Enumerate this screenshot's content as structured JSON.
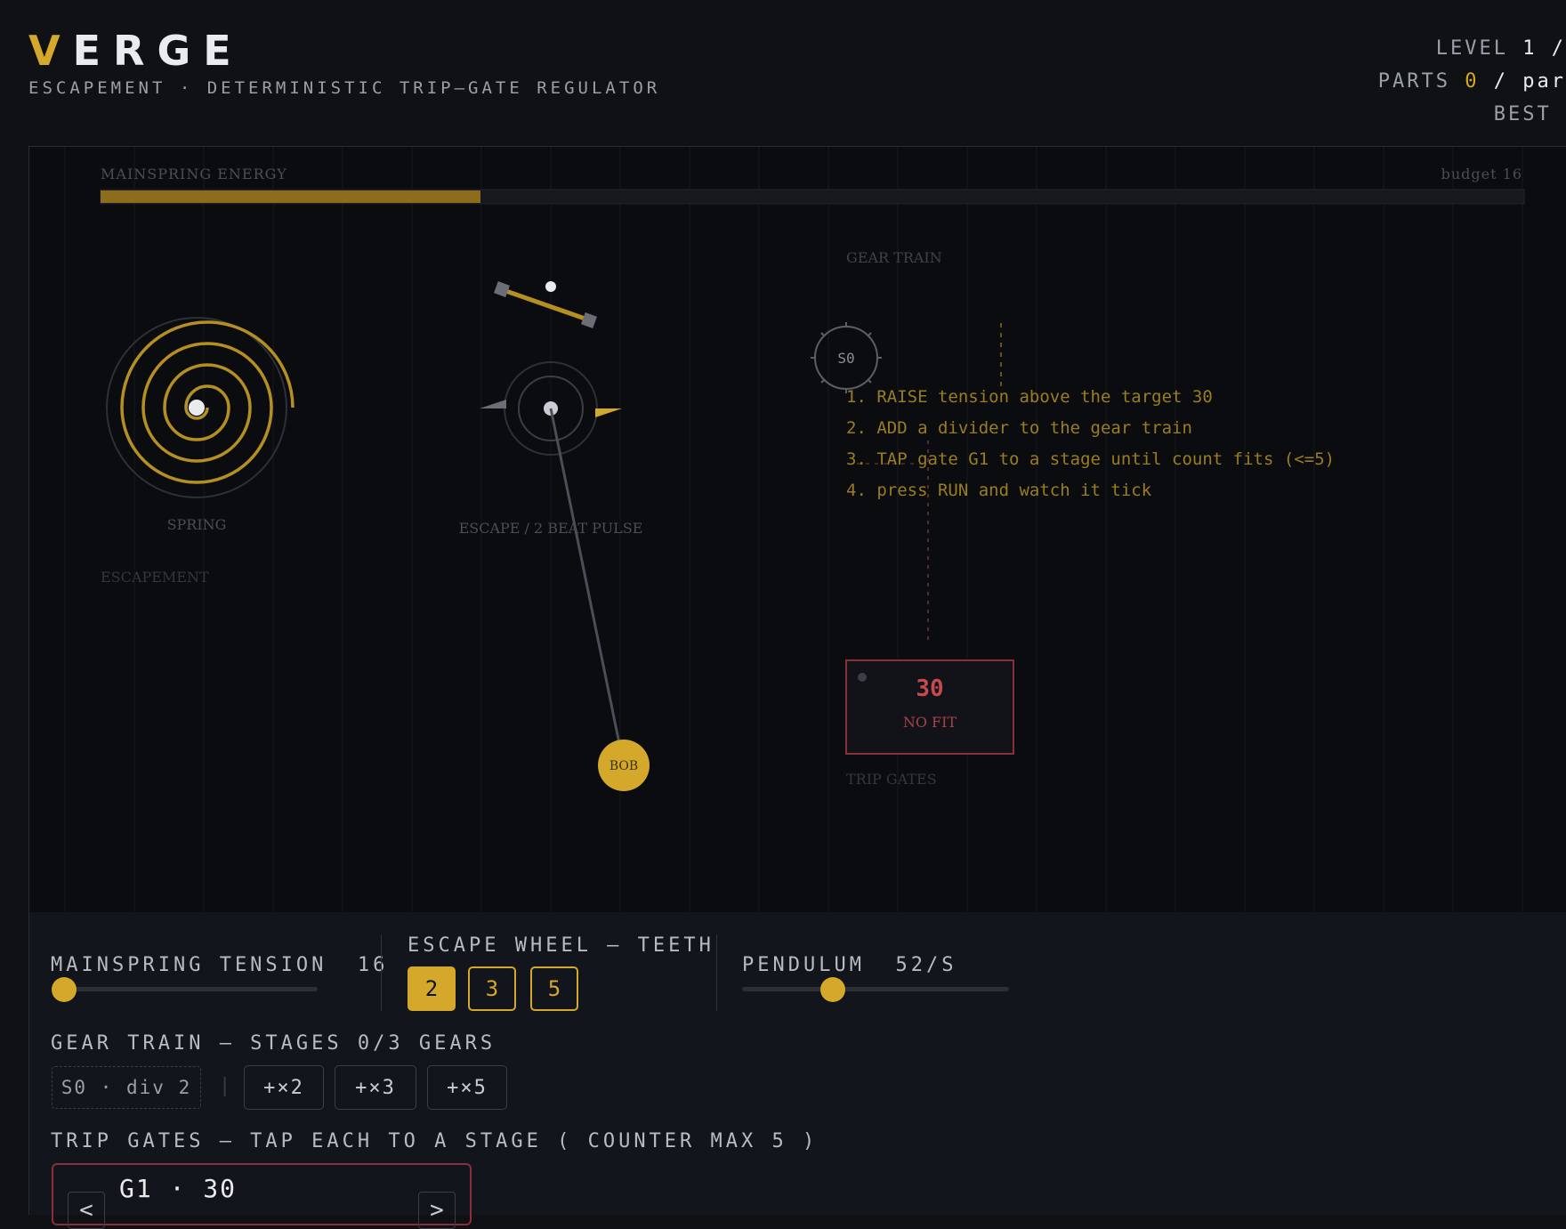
{
  "header": {
    "logo_first": "V",
    "logo_rest": "ERGE",
    "subtitle": "ESCAPEMENT · DETERMINISTIC TRIP–GATE REGULATOR"
  },
  "hud": {
    "level_label": "LEVEL",
    "level_value": "1 /",
    "parts_label": "PARTS",
    "parts_value": "0",
    "parts_rest": "/ par",
    "best_label": "BEST"
  },
  "board": {
    "energy_label": "MAINSPRING ENERGY",
    "budget_label": "budget 16",
    "energy_fill_fraction": 0.267,
    "spring_label": "SPRING",
    "escapement_label": "ESCAPEMENT",
    "escape_label": "ESCAPE / 2 BEAT PULSE",
    "bob_label": "BOB",
    "gear_train_label": "GEAR TRAIN",
    "gear_stage_label": "S0",
    "trip_gates_label": "TRIP GATES",
    "gate_count": "30",
    "gate_status": "NO FIT",
    "instructions": [
      "1. RAISE tension above the target 30",
      "2. ADD a divider to the gear train",
      "3. TAP gate G1 to a stage until count fits (<=5)",
      "4. press RUN and watch it tick"
    ],
    "colors": {
      "accent": "#d4a82a",
      "alert": "#c8484f",
      "background": "#0b0c0f"
    }
  },
  "controls": {
    "tension_label": "MAINSPRING TENSION",
    "tension_value": "16",
    "tension_fraction": 0.0,
    "escape_label": "ESCAPE WHEEL — TEETH",
    "teeth_options": [
      "2",
      "3",
      "5"
    ],
    "teeth_selected": "2",
    "pendulum_label": "PENDULUM",
    "pendulum_value": "52/S",
    "pendulum_fraction": 0.34,
    "gear_train_label": "GEAR TRAIN — STAGES 0/3 GEARS",
    "stage_chip": "S0 · div 2",
    "gear_divider_sep": "|",
    "gear_buttons": [
      "+×2",
      "+×3",
      "+×5"
    ],
    "trip_gates_label": "TRIP GATES — TAP EACH TO A STAGE ( COUNTER MAX 5 )",
    "gate_name": "G1 · 30",
    "gate_prev": "<",
    "gate_next": ">"
  }
}
